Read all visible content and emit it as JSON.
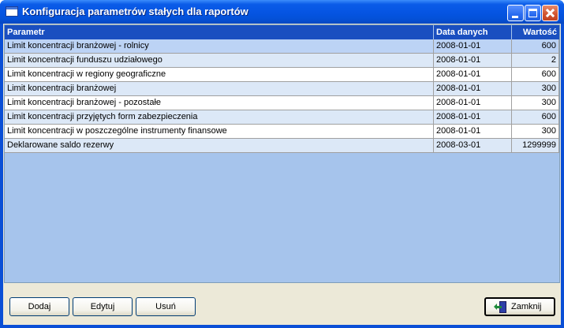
{
  "window": {
    "title": "Konfiguracja parametrów stałych dla raportów"
  },
  "grid": {
    "columns": [
      "Parametr",
      "Data danych",
      "Wartość"
    ],
    "rows": [
      {
        "name": "Limit koncentracji branżowej - rolnicy",
        "date": "2008-01-01",
        "value": "600"
      },
      {
        "name": "Limit koncentracji funduszu udziałowego",
        "date": "2008-01-01",
        "value": "2"
      },
      {
        "name": "Limit koncentracji w regiony geograficzne",
        "date": "2008-01-01",
        "value": "600"
      },
      {
        "name": "Limit koncentracji branżowej",
        "date": "2008-01-01",
        "value": "300"
      },
      {
        "name": "Limit koncentracji branżowej - pozostałe",
        "date": "2008-01-01",
        "value": "300"
      },
      {
        "name": "Limit koncentracji przyjętych form zabezpieczenia",
        "date": "2008-01-01",
        "value": "600"
      },
      {
        "name": "Limit koncentracji w poszczególne instrumenty finansowe",
        "date": "2008-01-01",
        "value": "300"
      },
      {
        "name": "Deklarowane saldo rezerwy",
        "date": "2008-03-01",
        "value": "1299999"
      }
    ]
  },
  "buttons": {
    "add": "Dodaj",
    "edit": "Edytuj",
    "delete": "Usuń",
    "close": "Zamknij"
  }
}
